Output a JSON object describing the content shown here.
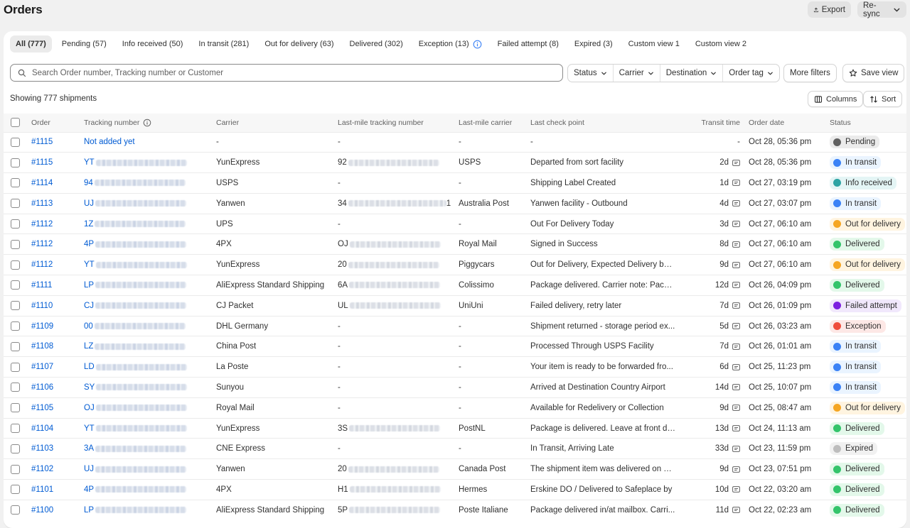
{
  "page": {
    "title": "Orders",
    "export_label": "Export",
    "resync_label": "Re-sync"
  },
  "tabs": [
    {
      "label": "All (777)",
      "active": true
    },
    {
      "label": "Pending (57)"
    },
    {
      "label": "Info received (50)"
    },
    {
      "label": "In transit (281)"
    },
    {
      "label": "Out for delivery (63)"
    },
    {
      "label": "Delivered (302)"
    },
    {
      "label": "Exception (13)",
      "info_icon": true
    },
    {
      "label": "Failed attempt (8)"
    },
    {
      "label": "Expired (3)"
    },
    {
      "label": "Custom view 1"
    },
    {
      "label": "Custom view 2"
    }
  ],
  "search": {
    "placeholder": "Search Order number, Tracking number or Customer",
    "value": ""
  },
  "filters": [
    "Status",
    "Carrier",
    "Destination",
    "Order tag"
  ],
  "more_filters_label": "More filters",
  "save_view_label": "Save view",
  "showing_label": "Showing 777 shipments",
  "columns_label": "Columns",
  "sort_label": "Sort",
  "table": {
    "headers": [
      "Order",
      "Tracking number",
      "Carrier",
      "Last-mile tracking number",
      "Last-mile carrier",
      "Last check point",
      "Transit time",
      "Order date",
      "Status"
    ],
    "rows": [
      {
        "order": "#1115",
        "tracking": "Not added yet",
        "tracking_prefix": "",
        "carrier": "-",
        "lm_prefix": "",
        "lm_dash": "-",
        "lm_carrier": "-",
        "checkpoint": "-",
        "transit": "-",
        "msg": false,
        "date": "Oct 28, 05:36 pm",
        "status": "Pending",
        "status_color": "#616161",
        "status_bg": "#ebebeb"
      },
      {
        "order": "#1115",
        "tracking": "",
        "tracking_prefix": "YT",
        "carrier": "YunExpress",
        "lm_prefix": "92",
        "lm_dash": "",
        "lm_carrier": "USPS",
        "checkpoint": "Departed from sort facility",
        "transit": "2d",
        "msg": true,
        "date": "Oct 28, 05:36 pm",
        "status": "In transit",
        "status_color": "#3b82f6",
        "status_bg": "#eaf4ff"
      },
      {
        "order": "#1114",
        "tracking": "",
        "tracking_prefix": "94",
        "carrier": "USPS",
        "lm_prefix": "",
        "lm_dash": "-",
        "lm_carrier": "-",
        "checkpoint": "Shipping Label Created",
        "transit": "1d",
        "msg": true,
        "date": "Oct 27, 03:19 pm",
        "status": "Info received",
        "status_color": "#2ca3a3",
        "status_bg": "#e4f5f5"
      },
      {
        "order": "#1113",
        "tracking": "",
        "tracking_prefix": "UJ",
        "carrier": "Yanwen",
        "lm_prefix": "34",
        "lm_suffix": "1",
        "lm_dash": "",
        "lm_carrier": "Australia Post",
        "checkpoint": "Yanwen facility - Outbound",
        "transit": "4d",
        "msg": true,
        "date": "Oct 27, 03:07 pm",
        "status": "In transit",
        "status_color": "#3b82f6",
        "status_bg": "#eaf4ff"
      },
      {
        "order": "#1112",
        "tracking": "",
        "tracking_prefix": "1Z",
        "carrier": "UPS",
        "lm_prefix": "",
        "lm_dash": "-",
        "lm_carrier": "-",
        "checkpoint": "Out For Delivery Today",
        "transit": "3d",
        "msg": true,
        "date": "Oct 27, 06:10 am",
        "status": "Out for delivery",
        "status_color": "#f5a623",
        "status_bg": "#fff4e0"
      },
      {
        "order": "#1112",
        "tracking": "",
        "tracking_prefix": "4P",
        "carrier": "4PX",
        "lm_prefix": "OJ",
        "lm_dash": "",
        "lm_carrier": "Royal Mail",
        "checkpoint": "Signed in Success",
        "transit": "8d",
        "msg": true,
        "date": "Oct 27, 06:10 am",
        "status": "Delivered",
        "status_color": "#34c46b",
        "status_bg": "#e3f8ea"
      },
      {
        "order": "#1112",
        "tracking": "",
        "tracking_prefix": "YT",
        "carrier": "YunExpress",
        "lm_prefix": "20",
        "lm_dash": "",
        "lm_carrier": "Piggycars",
        "checkpoint": "Out for Delivery, Expected Delivery by ...",
        "transit": "9d",
        "msg": true,
        "date": "Oct 27, 06:10 am",
        "status": "Out for delivery",
        "status_color": "#f5a623",
        "status_bg": "#fff4e0"
      },
      {
        "order": "#1111",
        "tracking": "",
        "tracking_prefix": "LP",
        "carrier": "AliExpress Standard Shipping",
        "lm_prefix": "6A",
        "lm_dash": "",
        "lm_carrier": "Colissimo",
        "checkpoint": "Package delivered. Carrier note: Packa...",
        "transit": "12d",
        "msg": true,
        "date": "Oct 26, 04:09 pm",
        "status": "Delivered",
        "status_color": "#34c46b",
        "status_bg": "#e3f8ea"
      },
      {
        "order": "#1110",
        "tracking": "",
        "tracking_prefix": "CJ",
        "carrier": "CJ Packet",
        "lm_prefix": "UL",
        "lm_dash": "",
        "lm_carrier": "UniUni",
        "checkpoint": "Failed delivery, retry later",
        "transit": "7d",
        "msg": true,
        "date": "Oct 26, 01:09 pm",
        "status": "Failed attempt",
        "status_color": "#7c1fe0",
        "status_bg": "#f1e8fc"
      },
      {
        "order": "#1109",
        "tracking": "",
        "tracking_prefix": "00",
        "carrier": "DHL Germany",
        "lm_prefix": "",
        "lm_dash": "-",
        "lm_carrier": "-",
        "checkpoint": "Shipment returned - storage period ex...",
        "transit": "5d",
        "msg": true,
        "date": "Oct 26, 03:23 am",
        "status": "Exception",
        "status_color": "#ef4d3c",
        "status_bg": "#fde8e6"
      },
      {
        "order": "#1108",
        "tracking": "",
        "tracking_prefix": "LZ",
        "carrier": "China Post",
        "lm_prefix": "",
        "lm_dash": "-",
        "lm_carrier": "-",
        "checkpoint": "Processed Through USPS Facility",
        "transit": "7d",
        "msg": true,
        "date": "Oct 26, 01:01 am",
        "status": "In transit",
        "status_color": "#3b82f6",
        "status_bg": "#eaf4ff"
      },
      {
        "order": "#1107",
        "tracking": "",
        "tracking_prefix": "LD",
        "carrier": "La Poste",
        "lm_prefix": "",
        "lm_dash": "-",
        "lm_carrier": "-",
        "checkpoint": "Your item is ready to be forwarded fro...",
        "transit": "6d",
        "msg": true,
        "date": "Oct 25, 11:23 pm",
        "status": "In transit",
        "status_color": "#3b82f6",
        "status_bg": "#eaf4ff"
      },
      {
        "order": "#1106",
        "tracking": "",
        "tracking_prefix": "SY",
        "carrier": "Sunyou",
        "lm_prefix": "",
        "lm_dash": "-",
        "lm_carrier": "-",
        "checkpoint": "Arrived at Destination Country Airport",
        "transit": "14d",
        "msg": true,
        "date": "Oct 25, 10:07 pm",
        "status": "In transit",
        "status_color": "#3b82f6",
        "status_bg": "#eaf4ff"
      },
      {
        "order": "#1105",
        "tracking": "",
        "tracking_prefix": "OJ",
        "carrier": "Royal Mail",
        "lm_prefix": "",
        "lm_dash": "-",
        "lm_carrier": "-",
        "checkpoint": "Available for Redelivery or Collection",
        "transit": "9d",
        "msg": true,
        "date": "Oct 25, 08:47 am",
        "status": "Out for delivery",
        "status_color": "#f5a623",
        "status_bg": "#fff4e0"
      },
      {
        "order": "#1104",
        "tracking": "",
        "tracking_prefix": "YT",
        "carrier": "YunExpress",
        "lm_prefix": "3S",
        "lm_dash": "",
        "lm_carrier": "PostNL",
        "checkpoint": "Package is delivered. Leave at front do...",
        "transit": "13d",
        "msg": true,
        "date": "Oct 24, 11:13 am",
        "status": "Delivered",
        "status_color": "#34c46b",
        "status_bg": "#e3f8ea"
      },
      {
        "order": "#1103",
        "tracking": "",
        "tracking_prefix": "3A",
        "carrier": "CNE Express",
        "lm_prefix": "",
        "lm_dash": "-",
        "lm_carrier": "-",
        "checkpoint": "In Transit, Arriving Late",
        "transit": "33d",
        "msg": true,
        "date": "Oct 23, 11:59 pm",
        "status": "Expired",
        "status_color": "#bdbdbd",
        "status_bg": "#f1f1f1"
      },
      {
        "order": "#1102",
        "tracking": "",
        "tracking_prefix": "UJ",
        "carrier": "Yanwen",
        "lm_prefix": "20",
        "lm_dash": "",
        "lm_carrier": "Canada Post",
        "checkpoint": "The shipment item was delivered on 8/...",
        "transit": "9d",
        "msg": true,
        "date": "Oct 23, 07:51 pm",
        "status": "Delivered",
        "status_color": "#34c46b",
        "status_bg": "#e3f8ea"
      },
      {
        "order": "#1101",
        "tracking": "",
        "tracking_prefix": "4P",
        "carrier": "4PX",
        "lm_prefix": "H1",
        "lm_dash": "",
        "lm_carrier": "Hermes",
        "checkpoint": "Erskine DO / Delivered to Safeplace by",
        "transit": "10d",
        "msg": true,
        "date": "Oct 22, 03:20 am",
        "status": "Delivered",
        "status_color": "#34c46b",
        "status_bg": "#e3f8ea"
      },
      {
        "order": "#1100",
        "tracking": "",
        "tracking_prefix": "LP",
        "carrier": "AliExpress Standard Shipping",
        "lm_prefix": "5P",
        "lm_dash": "",
        "lm_carrier": "Poste Italiane",
        "checkpoint": "Package delivered in/at mailbox. Carri...",
        "transit": "11d",
        "msg": true,
        "date": "Oct 22, 02:23 am",
        "status": "Delivered",
        "status_color": "#34c46b",
        "status_bg": "#e3f8ea"
      }
    ]
  }
}
